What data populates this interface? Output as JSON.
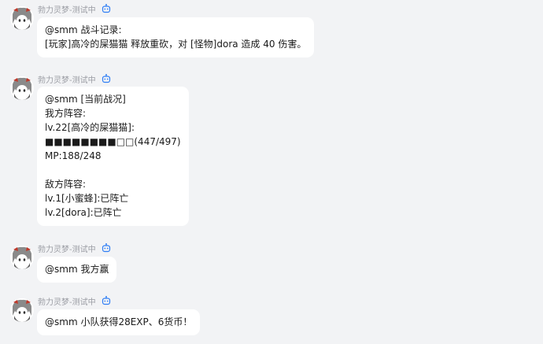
{
  "app": {
    "background": "#f2f3f5",
    "bubble_color": "#ffffff",
    "sender_color": "#9a9ca3",
    "badge_color": "#2f7ef5"
  },
  "messages": [
    {
      "sender": "勃力灵梦-测试中",
      "badge_icon": "bot-badge-icon",
      "avatar_icon": "avatar-anime-girl-icon",
      "lines": [
        "@smm 战斗记录:",
        "[玩家]高冷的屎猫猫 释放重砍，对 [怪物]dora 造成 40 伤害。"
      ]
    },
    {
      "sender": "勃力灵梦-测试中",
      "badge_icon": "bot-badge-icon",
      "avatar_icon": "avatar-anime-girl-icon",
      "lines": [
        "@smm [当前战况]",
        "我方阵容:",
        "lv.22[高冷的屎猫猫]:",
        "■■■■■■■■□□(447/497)",
        "MP:188/248",
        "",
        "敌方阵容:",
        "lv.1[小蜜蜂]:已阵亡",
        "lv.2[dora]:已阵亡"
      ]
    },
    {
      "sender": "勃力灵梦-测试中",
      "badge_icon": "bot-badge-icon",
      "avatar_icon": "avatar-anime-girl-icon",
      "lines": [
        "@smm 我方赢"
      ]
    },
    {
      "sender": "勃力灵梦-测试中",
      "badge_icon": "bot-badge-icon",
      "avatar_icon": "avatar-anime-girl-icon",
      "lines": [
        "@smm 小队获得28EXP、6货币！"
      ]
    }
  ]
}
